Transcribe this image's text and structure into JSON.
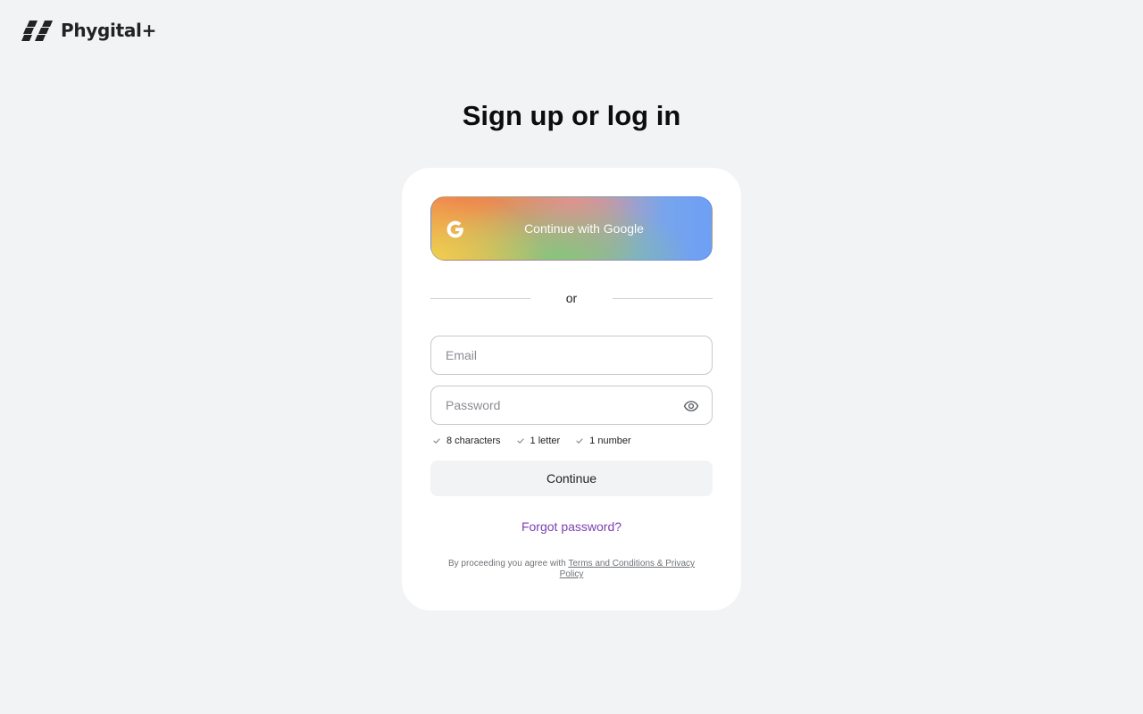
{
  "brand": {
    "name": "Phygital+",
    "logo_icon": "checkered-squares-icon",
    "logo_color": "#222222"
  },
  "heading": "Sign up or log in",
  "google_button": {
    "label": "Continue with Google",
    "icon": "google-g-icon"
  },
  "divider_text": "or",
  "email": {
    "value": "",
    "placeholder": "Email"
  },
  "password": {
    "value": "",
    "placeholder": "Password",
    "toggle_icon": "eye-icon"
  },
  "rules": [
    {
      "label": "8 characters",
      "icon": "check-icon"
    },
    {
      "label": "1 letter",
      "icon": "check-icon"
    },
    {
      "label": "1 number",
      "icon": "check-icon"
    }
  ],
  "continue_label": "Continue",
  "forgot_label": "Forgot password?",
  "legal": {
    "prefix": "By proceeding you agree with ",
    "link": "Terms and Conditions & Privacy Policy"
  },
  "colors": {
    "background": "#f2f3f5",
    "card": "#ffffff",
    "link": "#7b3fb1",
    "continue_bg": "#f2f3f5"
  }
}
